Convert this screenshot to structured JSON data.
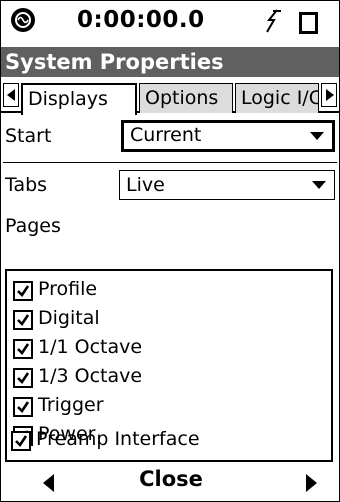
{
  "status": {
    "timer": "0:00:00.0"
  },
  "title": "System Properties",
  "tabs": [
    {
      "label": "Displays",
      "active": true
    },
    {
      "label": "Options",
      "active": false
    },
    {
      "label": "Logic I/C",
      "active": false
    }
  ],
  "start": {
    "label": "Start",
    "value": "Current"
  },
  "tabs_field": {
    "label": "Tabs",
    "value": "Live"
  },
  "pages": {
    "label": "Pages",
    "items": [
      {
        "label": "Profile",
        "checked": true
      },
      {
        "label": "Digital",
        "checked": true
      },
      {
        "label": "1/1 Octave",
        "checked": true
      },
      {
        "label": "1/3 Octave",
        "checked": true
      },
      {
        "label": "Trigger",
        "checked": true
      },
      {
        "label": "Power",
        "checked": true
      },
      {
        "label": "Preamp Interface",
        "checked": true
      }
    ]
  },
  "bottom": {
    "close_label": "Close"
  },
  "icons": {
    "logo": "device-logo-icon",
    "power": "power-plug-icon",
    "battery": "battery-icon",
    "prev": "arrow-left-icon",
    "next": "arrow-right-icon"
  }
}
